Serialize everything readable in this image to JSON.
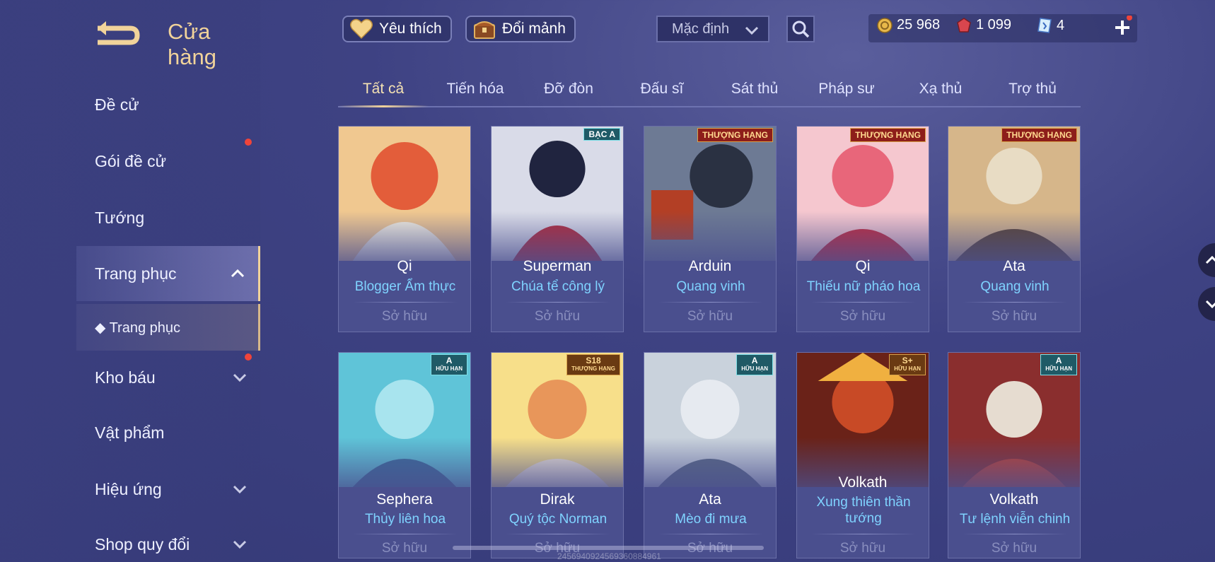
{
  "header": {
    "title": "Cửa hàng",
    "favorites_label": "Yêu thích",
    "exchange_label": "Đổi mảnh",
    "sort_value": "Mặc định"
  },
  "currency": {
    "gold": "25 968",
    "vouchers": "1 099",
    "tickets": "4"
  },
  "sidebar": {
    "items": [
      {
        "label": "Đề cử"
      },
      {
        "label": "Gói đề cử"
      },
      {
        "label": "Tướng"
      },
      {
        "label": "Trang phục"
      },
      {
        "label": "◆ Trang phục"
      },
      {
        "label": "Kho báu"
      },
      {
        "label": "Vật phẩm"
      },
      {
        "label": "Hiệu ứng"
      },
      {
        "label": "Shop quy đổi"
      }
    ]
  },
  "tabs": [
    "Tất cả",
    "Tiến hóa",
    "Đỡ đòn",
    "Đấu sĩ",
    "Sát thủ",
    "Pháp sư",
    "Xạ thủ",
    "Trợ thủ"
  ],
  "cards": [
    {
      "hero": "Qi",
      "skin": "Blogger Ẩm thực",
      "status": "Sở hữu",
      "art": [
        "#f0c890",
        "#e35d3a",
        "#f4f0e0"
      ]
    },
    {
      "hero": "Superman",
      "skin": "Chúa tể công lý",
      "status": "Sở hữu",
      "badge": "BẠC A",
      "art": [
        "#d9dbe8",
        "#b52b39",
        "#20243f"
      ]
    },
    {
      "hero": "Arduin",
      "skin": "Quang vinh",
      "status": "Sở hữu",
      "badge": "THƯỢNG HẠNG",
      "art": [
        "#6d7a94",
        "#b33f25",
        "#2a3142"
      ]
    },
    {
      "hero": "Qi",
      "skin": "Thiếu nữ pháo hoa",
      "status": "Sở hữu",
      "badge": "THƯỢNG HẠNG",
      "art": [
        "#f5c7cf",
        "#e8667a",
        "#c62a3c"
      ]
    },
    {
      "hero": "Ata",
      "skin": "Quang vinh",
      "status": "Sở hữu",
      "badge": "THƯỢNG HẠNG",
      "art": [
        "#d6b68a",
        "#5c4530",
        "#e8dcc4"
      ]
    },
    {
      "hero": "Sephera",
      "skin": "Thủy liên hoa",
      "status": "Sở hữu",
      "badge": "A",
      "badge_sub": "HỮU HẠN",
      "art": [
        "#5fc4d8",
        "#a8e4ee",
        "#3a6c9a"
      ]
    },
    {
      "hero": "Dirak",
      "skin": "Quý tộc Norman",
      "status": "Sở hữu",
      "badge": "S18",
      "badge_sub": "THƯỢNG HẠNG",
      "art": [
        "#f7df8a",
        "#e8965a",
        "#f3e8d8"
      ]
    },
    {
      "hero": "Ata",
      "skin": "Mèo đi mưa",
      "status": "Sở hữu",
      "badge": "A",
      "badge_sub": "HỮU HẠN",
      "art": [
        "#c9d2dc",
        "#5a6a84",
        "#e6eaf0"
      ]
    },
    {
      "hero": "Volkath",
      "skin": "Xung thiên thần tướng",
      "status": "Sở hữu",
      "badge": "S+",
      "badge_sub": "HỮU HẠN",
      "art": [
        "#c84a26",
        "#6a2218",
        "#f0b040"
      ]
    },
    {
      "hero": "Volkath",
      "skin": "Tư lệnh viễn chinh",
      "status": "Sở hữu",
      "badge": "A",
      "badge_sub": "HỮU HẠN",
      "art": [
        "#8a2e2e",
        "#e6dcd0",
        "#c04030"
      ]
    }
  ],
  "watermark": "2456940924569360884961",
  "colors": {
    "accent_gold": "#f1d39a",
    "skin_blue": "#7fd3ff",
    "notification_red": "#f0443a"
  }
}
